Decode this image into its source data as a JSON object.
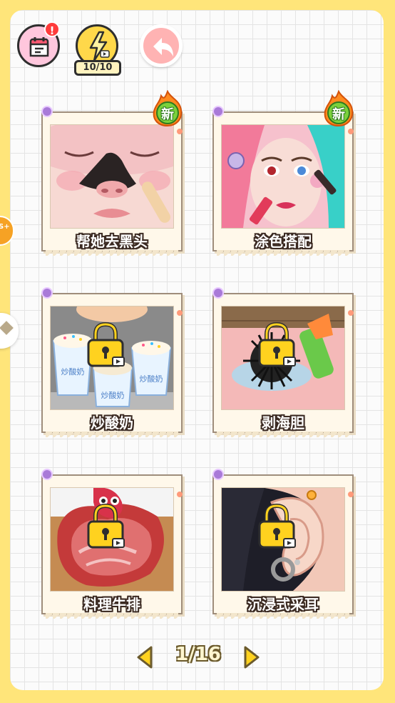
{
  "toolbar": {
    "calendar_icon": "calendar-icon",
    "alert_badge": "!",
    "energy_icon": "lightning-video-icon",
    "energy_count": "10/10",
    "back_icon": "back-arrow-icon"
  },
  "side": {
    "coin_text": "S+"
  },
  "badge_new": "新",
  "cards": [
    {
      "title": "帮她去黑头",
      "new": true,
      "locked": false,
      "theme": "face"
    },
    {
      "title": "涂色搭配",
      "new": true,
      "locked": false,
      "theme": "makeup"
    },
    {
      "title": "炒酸奶",
      "new": false,
      "locked": true,
      "theme": "yogurt",
      "cup_label": "炒酸奶"
    },
    {
      "title": "剥海胆",
      "new": false,
      "locked": true,
      "theme": "urchin"
    },
    {
      "title": "料理牛排",
      "new": false,
      "locked": true,
      "theme": "steak"
    },
    {
      "title": "沉浸式采耳",
      "new": false,
      "locked": true,
      "theme": "ear"
    }
  ],
  "pager": {
    "label": "1/16",
    "current": 1,
    "total": 16
  },
  "colors": {
    "background": "#ffe57a",
    "paper": "#fbfbfb",
    "lock": "#ffd21f",
    "new_badge": "#7bd13c"
  }
}
